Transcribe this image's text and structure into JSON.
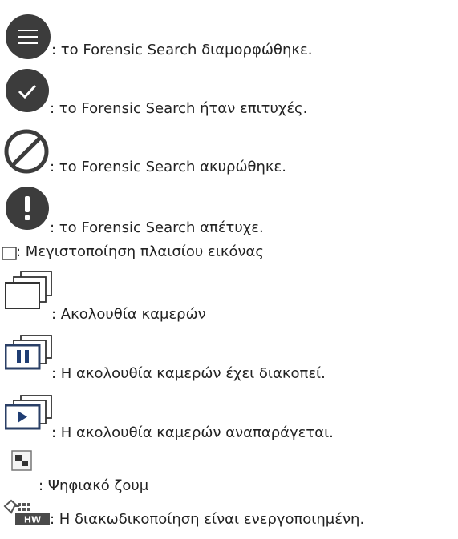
{
  "top_cut_text": "΄΄΄΄  ΄΄  ΄  ΄ ΄ ΄",
  "items": [
    {
      "icon": "list-status-icon",
      "text": ": το Forensic Search διαμορφώθηκε."
    },
    {
      "icon": "checkmark-status-icon",
      "text": ": το Forensic Search ήταν επιτυχές."
    },
    {
      "icon": "cancelled-status-icon",
      "text": ": το Forensic Search ακυρώθηκε."
    },
    {
      "icon": "error-status-icon",
      "text": ": το Forensic Search απέτυχε."
    },
    {
      "icon": "maximize-frame-icon",
      "text": ": Μεγιστοποίηση πλαισίου εικόνας"
    },
    {
      "icon": "camera-sequence-icon",
      "text": ": Ακολουθία καμερών"
    },
    {
      "icon": "sequence-paused-icon",
      "text": ": Η ακολουθία καμερών έχει διακοπεί."
    },
    {
      "icon": "sequence-playing-icon",
      "text": ": Η ακολουθία καμερών αναπαράγεται."
    },
    {
      "icon": "digital-zoom-icon",
      "text": ": Ψηφιακό ζουμ"
    },
    {
      "icon": "hw-decoding-icon",
      "text": ": Η διακωδικοποίηση είναι ενεργοποιημένη."
    }
  ]
}
